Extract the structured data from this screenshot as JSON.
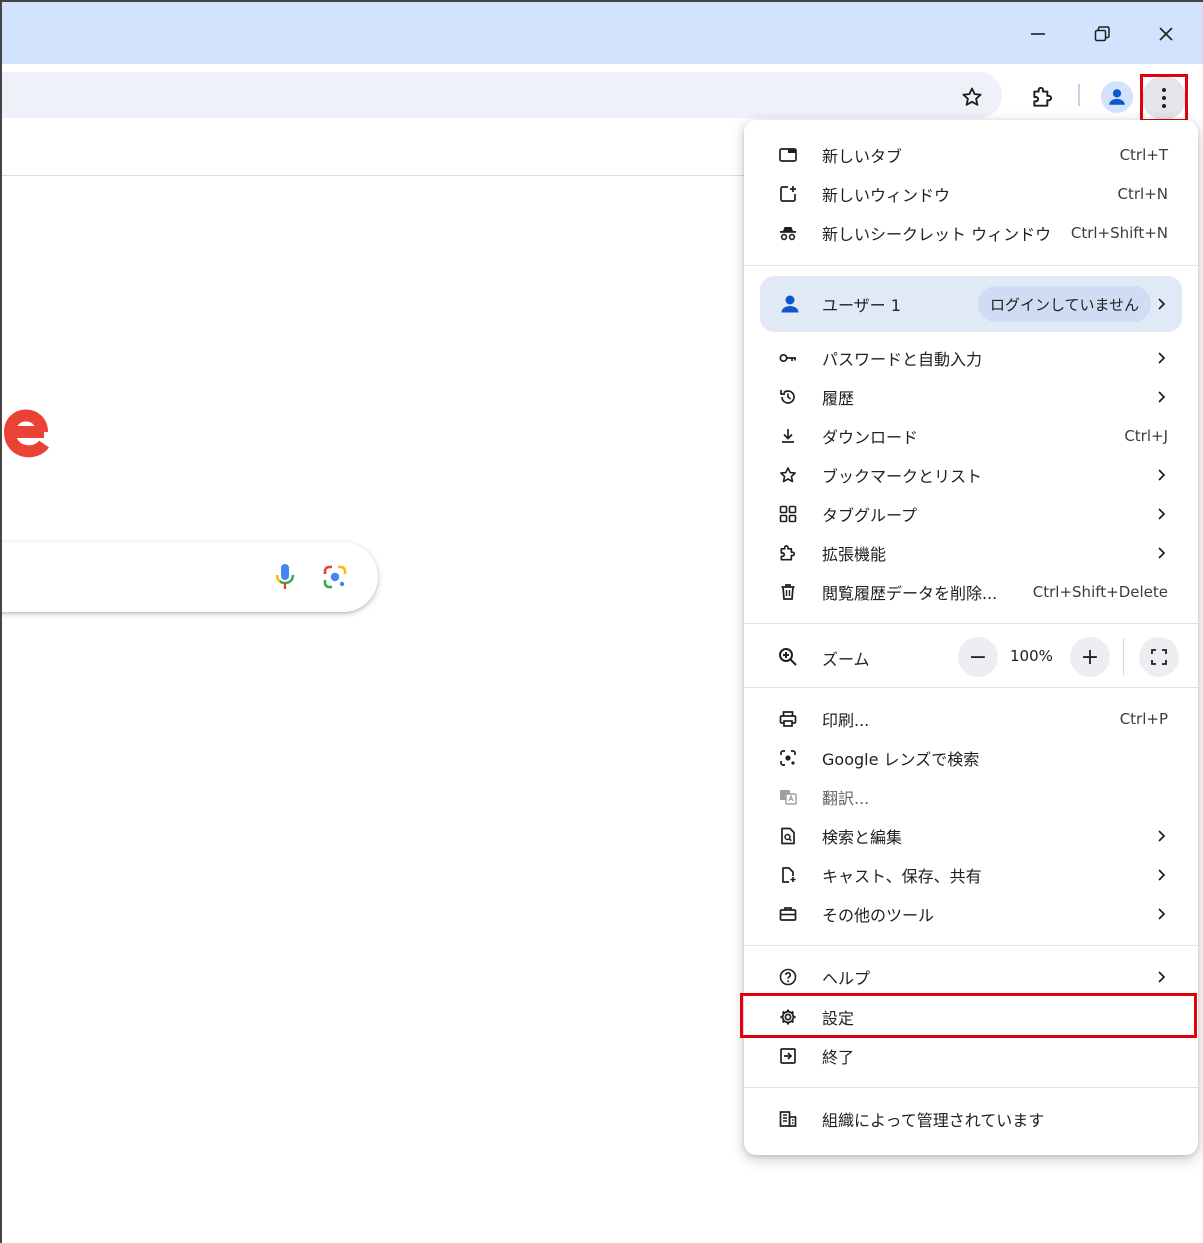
{
  "window": {
    "minimize_icon": "minimize-icon",
    "restore_icon": "restore-icon",
    "close_icon": "close-icon"
  },
  "toolbar": {
    "bookmark_icon": "star-icon",
    "extensions_icon": "puzzle-icon",
    "profile_icon": "account-icon",
    "menu_icon": "kebab-icon"
  },
  "menu": {
    "group1": [
      {
        "label": "新しいタブ",
        "shortcut": "Ctrl+T",
        "icon": "new-tab-icon"
      },
      {
        "label": "新しいウィンドウ",
        "shortcut": "Ctrl+N",
        "icon": "new-window-icon"
      },
      {
        "label": "新しいシークレット ウィンドウ",
        "shortcut": "Ctrl+Shift+N",
        "icon": "incognito-icon"
      }
    ],
    "profile": {
      "label": "ユーザー 1",
      "badge": "ログインしていません",
      "icon": "account-icon"
    },
    "group2": [
      {
        "label": "パスワードと自動入力",
        "shortcut": "",
        "icon": "key-icon"
      },
      {
        "label": "履歴",
        "shortcut": "",
        "icon": "history-icon"
      },
      {
        "label": "ダウンロード",
        "shortcut": "Ctrl+J",
        "icon": "download-icon"
      },
      {
        "label": "ブックマークとリスト",
        "shortcut": "",
        "icon": "star-icon"
      },
      {
        "label": "タブグループ",
        "shortcut": "",
        "icon": "tab-groups-icon"
      },
      {
        "label": "拡張機能",
        "shortcut": "",
        "icon": "puzzle-icon"
      },
      {
        "label": "閲覧履歴データを削除...",
        "shortcut": "Ctrl+Shift+Delete",
        "icon": "trash-icon"
      }
    ],
    "zoom": {
      "label": "ズーム",
      "value": "100%",
      "minus": "−",
      "plus": "+"
    },
    "group3": [
      {
        "label": "印刷...",
        "shortcut": "Ctrl+P",
        "icon": "print-icon"
      },
      {
        "label": "Google レンズで検索",
        "shortcut": "",
        "icon": "lens-icon"
      },
      {
        "label": "翻訳...",
        "shortcut": "",
        "icon": "translate-icon"
      },
      {
        "label": "検索と編集",
        "shortcut": "",
        "icon": "find-icon"
      },
      {
        "label": "キャスト、保存、共有",
        "shortcut": "",
        "icon": "cast-icon"
      },
      {
        "label": "その他のツール",
        "shortcut": "",
        "icon": "toolbox-icon"
      }
    ],
    "group4": [
      {
        "label": "ヘルプ",
        "shortcut": "",
        "icon": "help-icon"
      },
      {
        "label": "設定",
        "shortcut": "",
        "icon": "gear-icon"
      },
      {
        "label": "終了",
        "shortcut": "",
        "icon": "exit-icon"
      }
    ],
    "managed": {
      "label": "組織によって管理されています",
      "icon": "building-icon"
    }
  },
  "colors": {
    "titlebar": "#d3e3fd",
    "highlight": "#e3000b",
    "google_red": "#ea4335",
    "profile_bg": "#e1e9f7"
  }
}
